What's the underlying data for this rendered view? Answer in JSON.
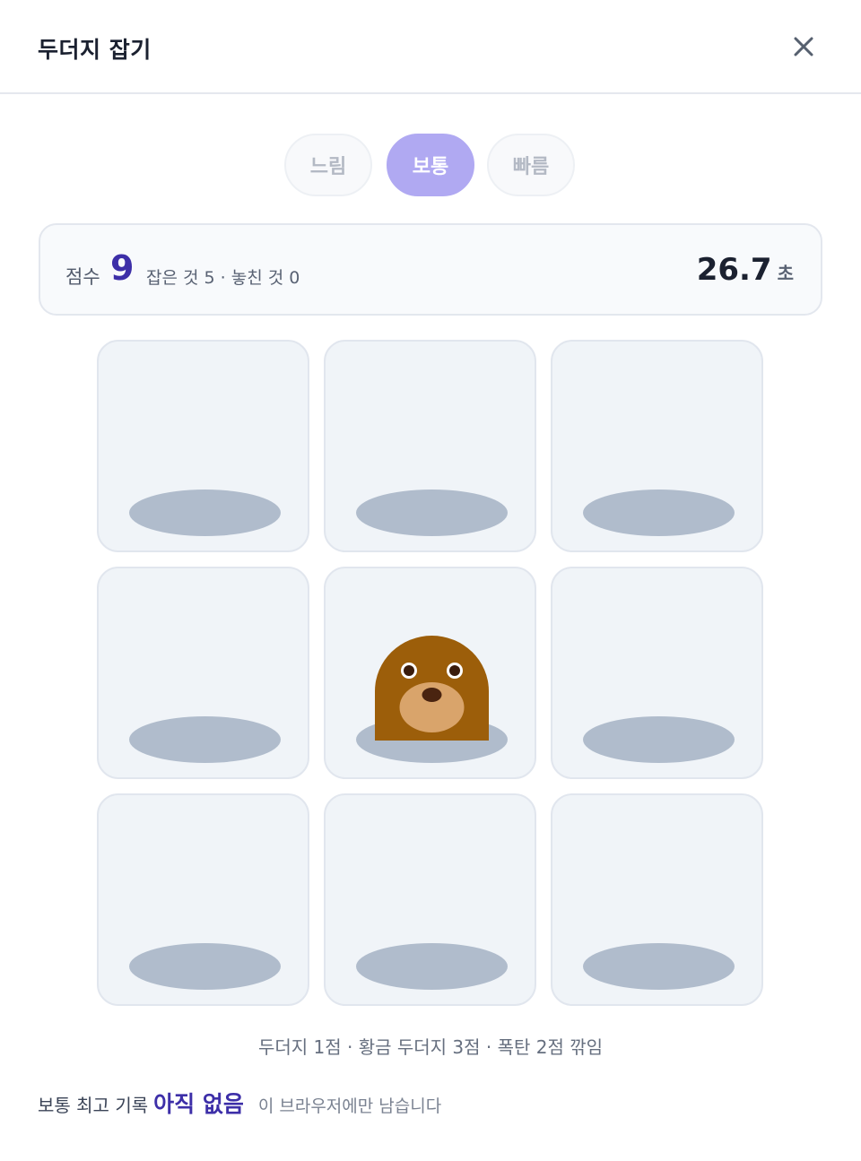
{
  "header": {
    "title": "두더지 잡기",
    "close_icon": "close-icon"
  },
  "speed": {
    "options": [
      "느림",
      "보통",
      "빠름"
    ],
    "selected": "보통"
  },
  "score": {
    "label": "점수",
    "value": "9",
    "detail": "잡은 것 5 · 놓친 것 0",
    "timer_value": "26.7",
    "timer_unit": "초"
  },
  "board": {
    "rows": 3,
    "cols": 3,
    "active_mole_index": 4,
    "mole_icon": "mole-icon"
  },
  "hint": "두더지 1점 · 황금 두더지 3점 · 폭탄 2점 깎임",
  "best": {
    "label": "보통 최고 기록",
    "value": "아직 없음",
    "note": "이 브라우저에만 남습니다"
  },
  "colors": {
    "accent": "#3d2fa8",
    "active_button": "#b0a9f2",
    "hole": "#b0bccc",
    "mole_body": "#9c5e0a",
    "mole_snout": "#d9a46b"
  }
}
